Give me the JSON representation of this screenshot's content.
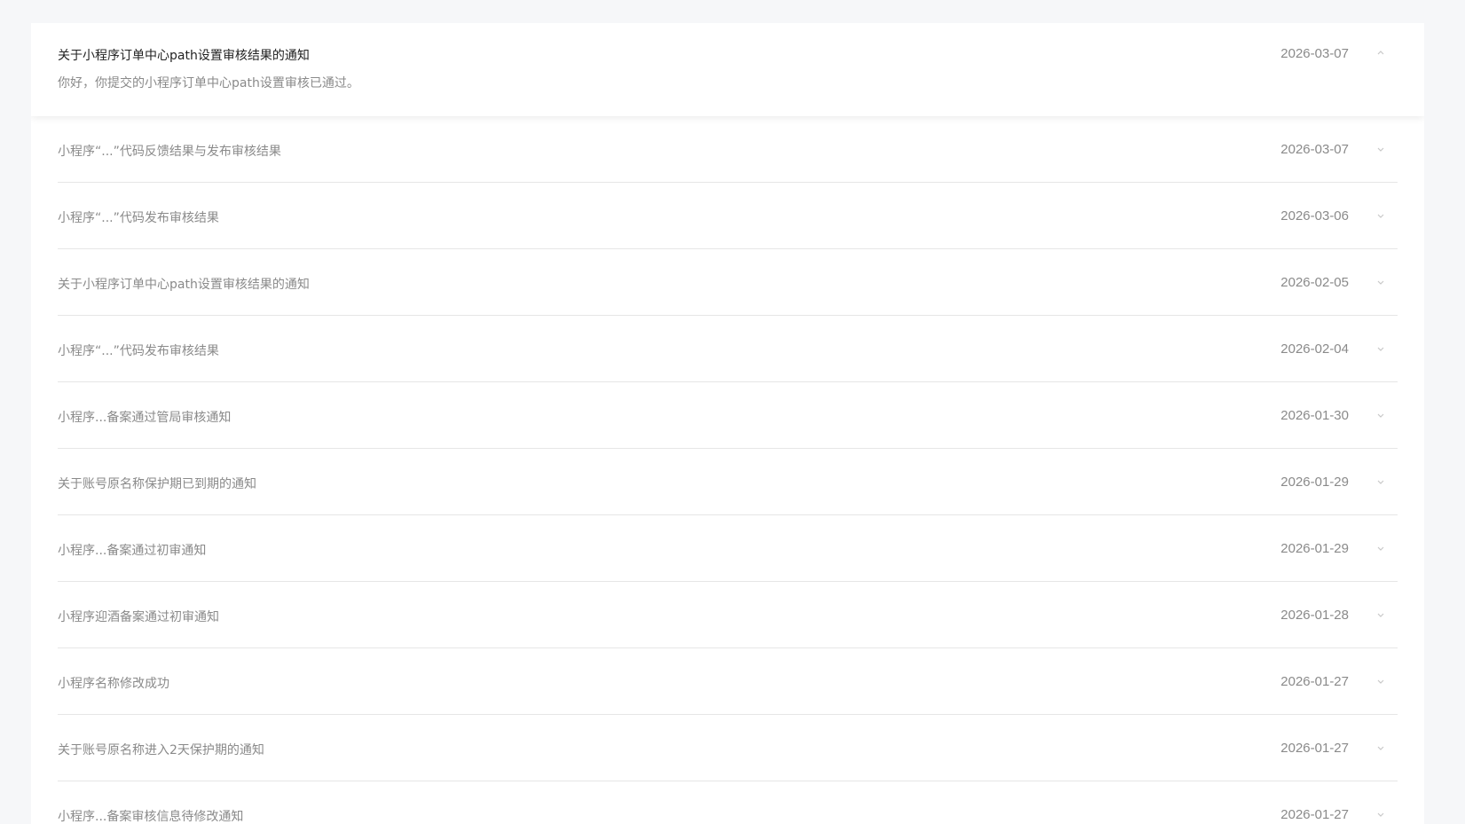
{
  "expanded_item": {
    "title": "关于小程序订单中心path设置审核结果的通知",
    "description": "你好，你提交的小程序订单中心path设置审核已通过。",
    "date": "2026-03-07"
  },
  "items": [
    {
      "title": "小程序“...”代码反馈结果与发布审核结果",
      "date": "2026-03-07"
    },
    {
      "title": "小程序“...”代码发布审核结果",
      "date": "2026-03-06"
    },
    {
      "title": "关于小程序订单中心path设置审核结果的通知",
      "date": "2026-02-05"
    },
    {
      "title": "小程序“...”代码发布审核结果",
      "date": "2026-02-04"
    },
    {
      "title": "小程序...备案通过管局审核通知",
      "date": "2026-01-30"
    },
    {
      "title": "关于账号原名称保护期已到期的通知",
      "date": "2026-01-29"
    },
    {
      "title": "小程序...备案通过初审通知",
      "date": "2026-01-29"
    },
    {
      "title": "小程序迎酒备案通过初审通知",
      "date": "2026-01-28"
    },
    {
      "title": "小程序名称修改成功",
      "date": "2026-01-27"
    },
    {
      "title": "关于账号原名称进入2天保护期的通知",
      "date": "2026-01-27"
    },
    {
      "title": "小程序...备案审核信息待修改通知",
      "date": "2026-01-27"
    }
  ],
  "icons": {
    "collapse": "chevron-up-icon",
    "expand": "chevron-down-icon"
  }
}
